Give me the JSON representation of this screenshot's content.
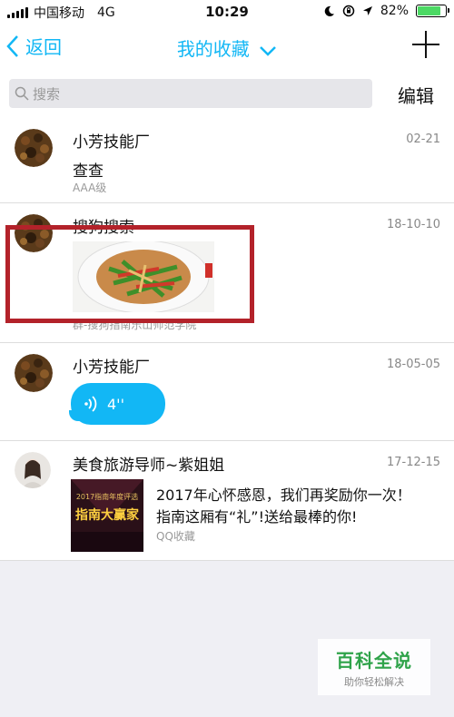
{
  "status_bar": {
    "carrier": "中国移动",
    "network": "4G",
    "time": "10:29",
    "battery": "82%",
    "battery_level": 0.82
  },
  "nav": {
    "back_label": "返回",
    "title": "我的收藏"
  },
  "search": {
    "placeholder": "搜索",
    "edit_label": "编辑"
  },
  "items": [
    {
      "name": "小芳技能厂",
      "date": "02-21",
      "text": "查查",
      "sub": "AAA级"
    },
    {
      "name": "搜狗搜索",
      "date": "18-10-10",
      "sub": "群-搜狗指南乐山师范学院"
    },
    {
      "name": "小芳技能厂",
      "date": "18-05-05",
      "voice_duration": "4''"
    },
    {
      "name": "美食旅游导师~紫姐姐",
      "date": "17-12-15",
      "line1": "2017年心怀感恩，我们再奖励你一次！",
      "line2": "指南这厢有“礼”!送给最棒的你!",
      "sub": "QQ收藏",
      "thumb_text_top": "2017指南年度评选",
      "thumb_text_main": "指南大赢家"
    }
  ],
  "watermark": {
    "title": "百科全说",
    "subtitle": "助你轻松解决"
  },
  "colors": {
    "accent": "#12b7f5",
    "highlight_border": "#b3222a"
  }
}
